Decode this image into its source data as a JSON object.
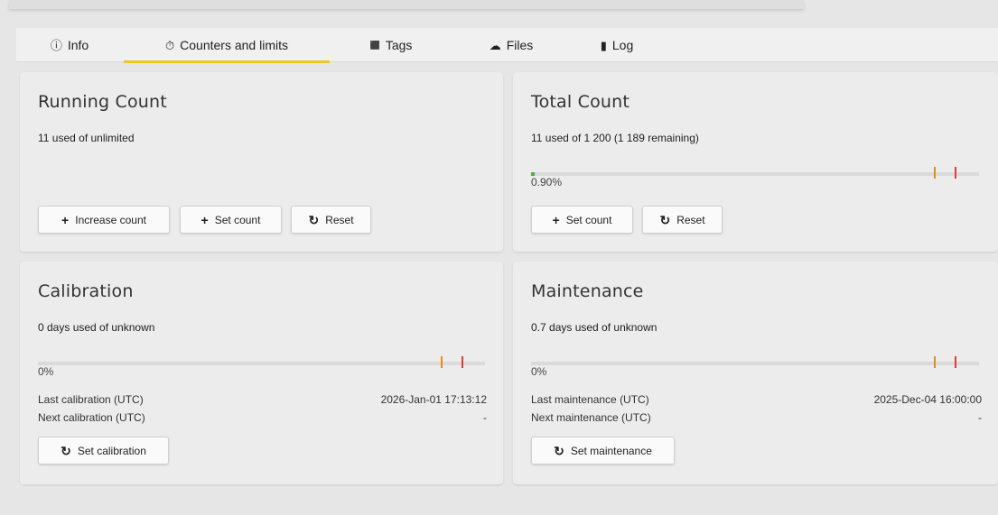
{
  "tabs": [
    {
      "label": "Info",
      "icon": "info-circle-icon",
      "glyph": "ⓘ"
    },
    {
      "label": "Counters and limits",
      "icon": "stopwatch-icon",
      "glyph": "⏱"
    },
    {
      "label": "Tags",
      "icon": "tag-icon",
      "glyph": "⬛"
    },
    {
      "label": "Files",
      "icon": "cloud-upload-icon",
      "glyph": "☁"
    },
    {
      "label": "Log",
      "icon": "log-book-icon",
      "glyph": "▮"
    }
  ],
  "active_tab": "Counters and limits",
  "accent_color": "#f2c230",
  "status_colors": {
    "fill": "#4caf50",
    "warning": "#e88a1a",
    "critical": "#e53935"
  },
  "running": {
    "title": "Running Count",
    "usage": "11 used of unlimited",
    "buttons": {
      "increase": "Increase count",
      "set": "Set count",
      "reset": "Reset"
    }
  },
  "total": {
    "title": "Total Count",
    "usage": "11 used of 1 200 (1 189 remaining)",
    "percent_label": "0.90%",
    "percent_value": 0.9,
    "buttons": {
      "set": "Set count",
      "reset": "Reset"
    }
  },
  "calibration": {
    "title": "Calibration",
    "usage": "0 days used of unknown",
    "percent_label": "0%",
    "last_label": "Last calibration (UTC)",
    "last_value": "2026-Jan-01 17:13:12",
    "next_label": "Next calibration (UTC)",
    "next_value": "-",
    "button": "Set calibration"
  },
  "maintenance": {
    "title": "Maintenance",
    "usage": "0.7 days used of unknown",
    "percent_label": "0%",
    "last_label": "Last maintenance (UTC)",
    "last_value": "2025-Dec-04 16:00:00",
    "next_label": "Next maintenance (UTC)",
    "next_value": "-",
    "button": "Set maintenance"
  }
}
